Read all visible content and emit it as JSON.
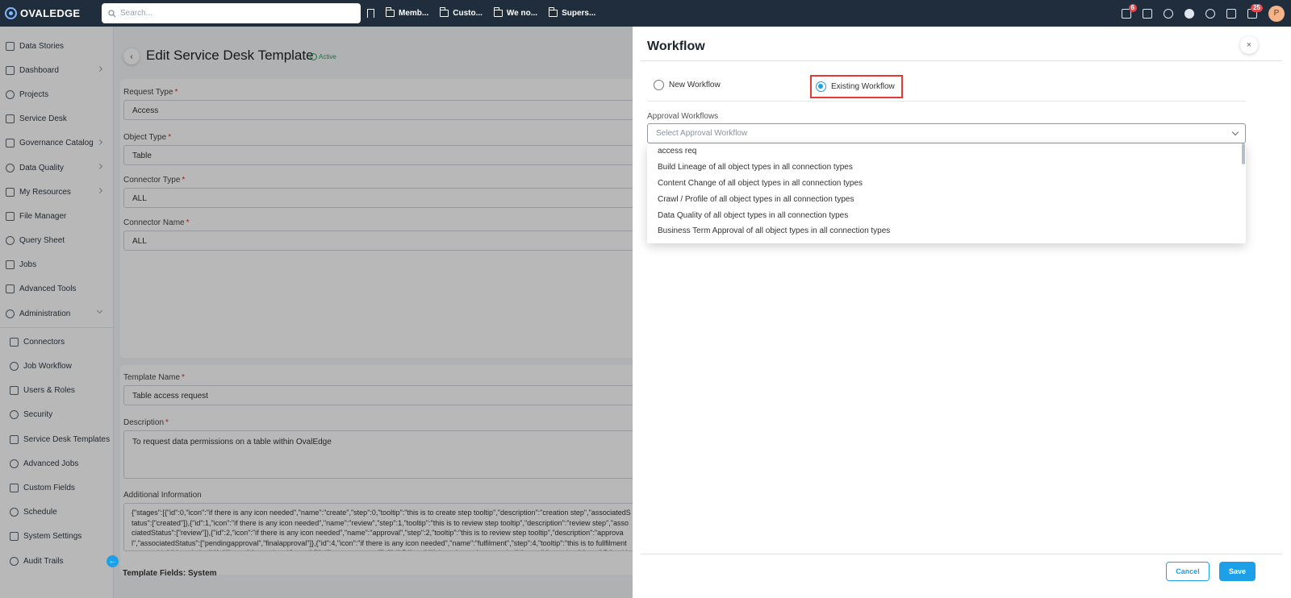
{
  "app": {
    "logo": "OVALEDGE",
    "search_placeholder": "Search...",
    "bookmarks": [
      "Memb...",
      "Custo...",
      "We no...",
      "Supers..."
    ],
    "badges": {
      "tasks": "6",
      "messages": "25"
    },
    "avatar_letter": "P"
  },
  "sidebar": {
    "items": [
      {
        "label": "Data Stories",
        "icon": "book-icon",
        "chevron": ""
      },
      {
        "label": "Dashboard",
        "icon": "dashboard-icon",
        "chevron": "right"
      },
      {
        "label": "Projects",
        "icon": "projects-icon",
        "chevron": ""
      },
      {
        "label": "Service Desk",
        "icon": "service-desk-icon",
        "chevron": ""
      },
      {
        "label": "Governance Catalog",
        "icon": "governance-icon",
        "chevron": "right"
      },
      {
        "label": "Data Quality",
        "icon": "data-quality-icon",
        "chevron": "right"
      },
      {
        "label": "My Resources",
        "icon": "resources-icon",
        "chevron": "right"
      },
      {
        "label": "File Manager",
        "icon": "folder-icon",
        "chevron": ""
      },
      {
        "label": "Query Sheet",
        "icon": "query-icon",
        "chevron": ""
      },
      {
        "label": "Jobs",
        "icon": "jobs-icon",
        "chevron": ""
      },
      {
        "label": "Advanced Tools",
        "icon": "tools-icon",
        "chevron": ""
      },
      {
        "label": "Administration",
        "icon": "admin-icon",
        "chevron": "down"
      }
    ],
    "sub_items": [
      {
        "label": "Connectors",
        "icon": "connectors-icon"
      },
      {
        "label": "Job Workflow",
        "icon": "workflow-icon"
      },
      {
        "label": "Users & Roles",
        "icon": "users-icon"
      },
      {
        "label": "Security",
        "icon": "lock-icon"
      },
      {
        "label": "Service Desk Templates",
        "icon": "template-icon"
      },
      {
        "label": "Advanced Jobs",
        "icon": "gears-icon"
      },
      {
        "label": "Custom Fields",
        "icon": "fields-icon"
      },
      {
        "label": "Schedule",
        "icon": "calendar-icon"
      },
      {
        "label": "System Settings",
        "icon": "wrench-icon"
      },
      {
        "label": "Audit Trails",
        "icon": "hourglass-icon"
      }
    ]
  },
  "main": {
    "title": "Edit Service Desk Template",
    "status": "Active",
    "fields": {
      "request_type": {
        "label": "Request Type",
        "value": "Access"
      },
      "object_type": {
        "label": "Object Type",
        "value": "Table"
      },
      "connector_type": {
        "label": "Connector Type",
        "value": "ALL"
      },
      "connector_name": {
        "label": "Connector Name",
        "value": "ALL"
      },
      "template_name": {
        "label": "Template Name",
        "value": "Table access request"
      },
      "description": {
        "label": "Description",
        "value": "To request data permissions on a table within OvalEdge"
      },
      "additional_info": {
        "label": "Additional Information",
        "value": "{\"stages\":[{\"id\":0,\"icon\":\"if there is any icon needed\",\"name\":\"create\",\"step\":0,\"tooltip\":\"this is to create step tooltip\",\"description\":\"creation step\",\"associatedStatus\":[\"created\"]},{\"id\":1,\"icon\":\"if there is any icon needed\",\"name\":\"review\",\"step\":1,\"tooltip\":\"this is to review step tooltip\",\"description\":\"review step\",\"associatedStatus\":[\"review\"]},{\"id\":2,\"icon\":\"if there is any icon needed\",\"name\":\"approval\",\"step\":2,\"tooltip\":\"this is to review step tooltip\",\"description\":\"approval\",\"associatedStatus\":[\"pendingapproval\",\"finalapproval\"]},{\"id\":4,\"icon\":\"if there is any icon needed\",\"name\":\"fulfilment\",\"step\":4,\"tooltip\":\"this is to fullfilment step tooltip\",\"description\":\"fullfilment\",\"associatedStatus\":[\"fulfilment progress\"]},{\"id\":5,\"icon\":\"if there is any icon needed\",\"name\":\"complete\",\"step\":5,\"tooltip\":\"this is to complete step tooltip\"}]}"
      }
    },
    "template_fields_label": "Template Fields: System"
  },
  "drawer": {
    "title": "Workflow",
    "radio_new": "New Workflow",
    "radio_existing": "Existing Workflow",
    "approval_label": "Approval Workflows",
    "select_placeholder": "Select Approval Workflow",
    "options": [
      "access req",
      "Build Lineage of all object types in all connection types",
      "Content Change of all object types in all connection types",
      "Crawl / Profile of all object types in all connection types",
      "Data Quality of all object types in all connection types",
      "Business Term Approval of all object types in all connection types"
    ],
    "cancel_label": "Cancel",
    "save_label": "Save"
  },
  "colors": {
    "accent": "#1ea0e8",
    "topbar": "#1f2d3d",
    "highlight": "#e53935"
  }
}
